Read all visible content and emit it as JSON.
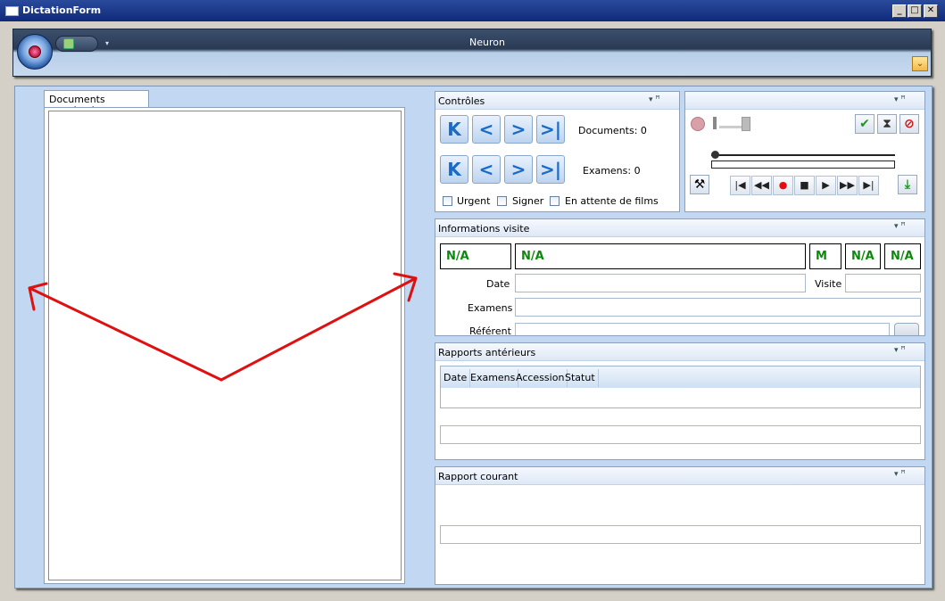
{
  "window": {
    "title": "DictationForm",
    "min_label": "_",
    "max_label": "□",
    "close_label": "✕"
  },
  "ribbon": {
    "title": "Neuron",
    "qat_dropdown": "▾",
    "minimize_label": "⌄"
  },
  "documents": {
    "tab_label": "Documents numérisés"
  },
  "controles": {
    "title": "Contrôles",
    "pin": "▾  ꟸ",
    "documents_label": "Documents: 0",
    "examens_label": "Examens: 0",
    "nav": {
      "first": "K",
      "prev": "<",
      "next": ">",
      "last": ">|"
    },
    "checkboxes": [
      {
        "label": "Urgent"
      },
      {
        "label": "Signer"
      },
      {
        "label": "En attente de films"
      }
    ]
  },
  "dictation": {
    "pin": "▾  ꟸ",
    "media": [
      "|◀",
      "◀◀",
      "●",
      "■",
      "▶",
      "▶▶",
      "▶|"
    ]
  },
  "visite": {
    "title": "Informations visite",
    "pin": "▾  ꟸ",
    "na1": "N/A",
    "na2": "N/A",
    "sex": "M",
    "na3": "N/A",
    "na4": "N/A",
    "date_label": "Date",
    "visite_label": "Visite",
    "examens_label": "Examens",
    "referent_label": "Référent"
  },
  "rapports": {
    "title": "Rapports antérieurs",
    "pin": "▾  ꟸ",
    "columns": [
      "Date",
      "Examens",
      "Accession",
      "Statut"
    ]
  },
  "courant": {
    "title": "Rapport courant",
    "pin": "▾  ꟸ"
  },
  "colors": {
    "accent": "#c2d8f2",
    "na_text": "#0a8a0a",
    "annotation": "#e01010"
  }
}
